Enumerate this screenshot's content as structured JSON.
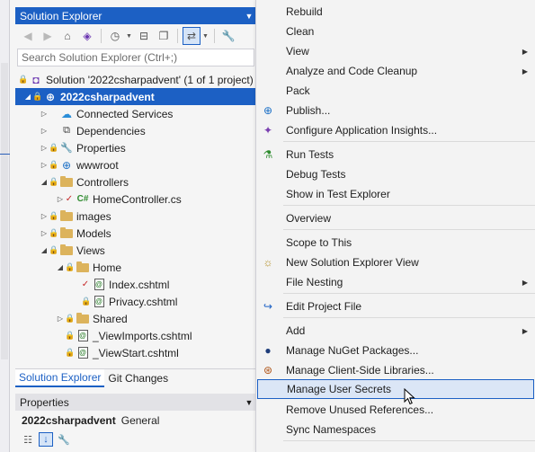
{
  "solution_explorer": {
    "title": "Solution Explorer",
    "search_placeholder": "Search Solution Explorer (Ctrl+;)",
    "toolbar_icons": [
      "back-icon",
      "forward-icon",
      "home-icon",
      "visual-studio-icon",
      "pending-changes-icon",
      "collapse-all-icon",
      "show-all-files-icon",
      "sync-icon",
      "wrench-icon"
    ],
    "tree": [
      {
        "label": "Solution '2022csharpadvent' (1 of 1 project)",
        "icon": "solution-icon"
      },
      {
        "label": "2022csharpadvent",
        "icon": "web-project-icon",
        "selected": true
      },
      {
        "label": "Connected Services",
        "icon": "cloud-icon"
      },
      {
        "label": "Dependencies",
        "icon": "dependencies-icon"
      },
      {
        "label": "Properties",
        "icon": "wrench-icon"
      },
      {
        "label": "wwwroot",
        "icon": "globe-icon"
      },
      {
        "label": "Controllers",
        "icon": "folder-icon"
      },
      {
        "label": "HomeController.cs",
        "icon": "csharp-file-icon"
      },
      {
        "label": "images",
        "icon": "folder-icon"
      },
      {
        "label": "Models",
        "icon": "folder-icon"
      },
      {
        "label": "Views",
        "icon": "folder-icon"
      },
      {
        "label": "Home",
        "icon": "folder-icon"
      },
      {
        "label": "Index.cshtml",
        "icon": "razor-file-icon"
      },
      {
        "label": "Privacy.cshtml",
        "icon": "razor-file-icon"
      },
      {
        "label": "Shared",
        "icon": "folder-icon"
      },
      {
        "label": "_ViewImports.cshtml",
        "icon": "razor-file-icon"
      },
      {
        "label": "_ViewStart.cshtml",
        "icon": "razor-file-icon"
      }
    ],
    "tabs": [
      "Solution Explorer",
      "Git Changes"
    ]
  },
  "properties": {
    "title": "Properties",
    "object_name": "2022csharpadvent",
    "object_type": "General"
  },
  "context_menu": {
    "items": [
      {
        "label": "Rebuild"
      },
      {
        "label": "Clean"
      },
      {
        "label": "View",
        "submenu": true
      },
      {
        "label": "Analyze and Code Cleanup",
        "submenu": true
      },
      {
        "label": "Pack"
      },
      {
        "label": "Publish...",
        "icon": "publish-globe-icon"
      },
      {
        "label": "Configure Application Insights...",
        "icon": "app-insights-icon"
      },
      {
        "label": "Run Tests",
        "icon": "run-tests-icon"
      },
      {
        "label": "Debug Tests"
      },
      {
        "label": "Show in Test Explorer"
      },
      {
        "label": "Overview"
      },
      {
        "label": "Scope to This"
      },
      {
        "label": "New Solution Explorer View",
        "icon": "new-view-icon"
      },
      {
        "label": "File Nesting",
        "submenu": true
      },
      {
        "label": "Edit Project File",
        "icon": "edit-project-icon"
      },
      {
        "label": "Add",
        "submenu": true
      },
      {
        "label": "Manage NuGet Packages...",
        "icon": "nuget-icon"
      },
      {
        "label": "Manage Client-Side Libraries...",
        "icon": "client-libraries-icon"
      },
      {
        "label": "Manage User Secrets",
        "highlighted": true
      },
      {
        "label": "Remove Unused References..."
      },
      {
        "label": "Sync Namespaces"
      }
    ]
  },
  "colors": {
    "accent": "#1c60c4",
    "highlight_bg": "#dbe6f6",
    "menu_bg": "#f3f3f3"
  }
}
